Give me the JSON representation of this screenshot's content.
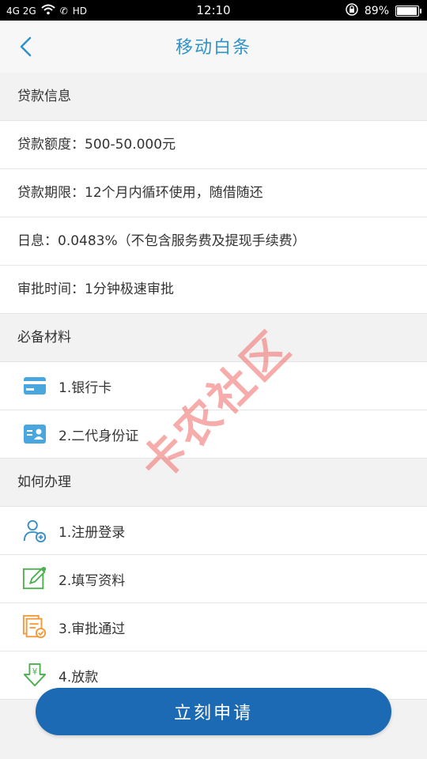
{
  "status": {
    "signal": "4G  2G",
    "network_extra": "HD",
    "time": "12:10",
    "battery": "89%",
    "battery_level": 0.89
  },
  "nav": {
    "title": "移动白条"
  },
  "loan_info": {
    "title": "贷款信息",
    "rows": [
      "贷款额度：500-50.000元",
      "贷款期限：12个月内循环使用，随借随还",
      "日息：0.0483%（不包含服务费及提现手续费）",
      "审批时间：1分钟极速审批"
    ]
  },
  "materials": {
    "title": "必备材料",
    "items": [
      {
        "label": "1.银行卡",
        "icon": "bank-card-icon"
      },
      {
        "label": "2.二代身份证",
        "icon": "id-card-icon"
      }
    ]
  },
  "process": {
    "title": "如何办理",
    "items": [
      {
        "label": "1.注册登录",
        "icon": "user-add-icon"
      },
      {
        "label": "2.填写资料",
        "icon": "edit-icon"
      },
      {
        "label": "3.审批通过",
        "icon": "approval-icon"
      },
      {
        "label": "4.放款",
        "icon": "download-money-icon"
      }
    ]
  },
  "watermark": "卡农社区",
  "apply_button": "立刻申请",
  "colors": {
    "accent": "#2f93c7",
    "button": "#1c6ab3",
    "watermark": "#f26a6a"
  }
}
